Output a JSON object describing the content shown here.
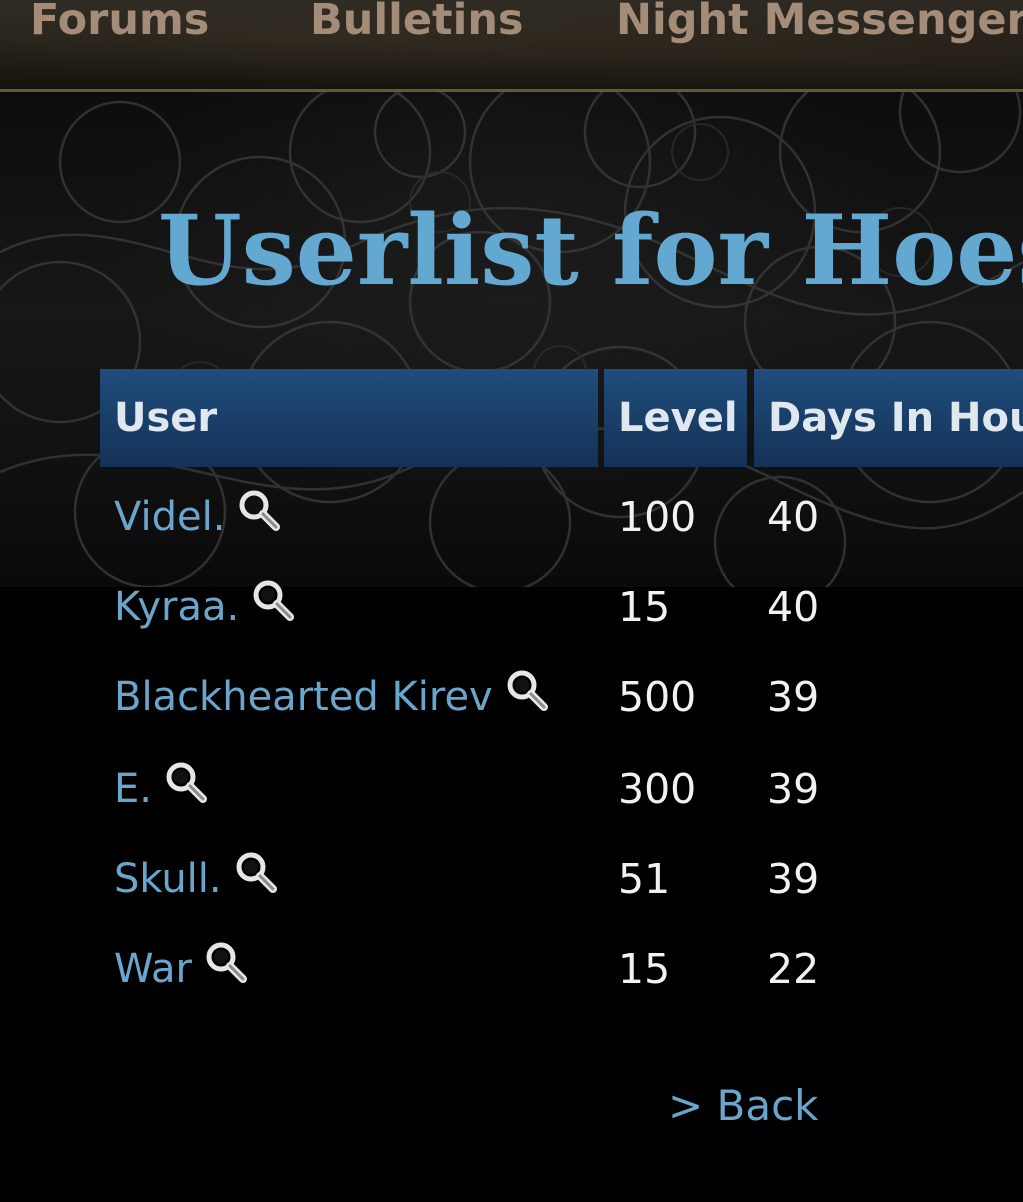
{
  "nav": {
    "items": [
      {
        "label": "Forums"
      },
      {
        "label": "Bulletins"
      },
      {
        "label": "Night Messenger"
      }
    ]
  },
  "page": {
    "title": "Userlist for Hoes"
  },
  "table": {
    "columns": [
      "User",
      "Level",
      "Days In Hou"
    ],
    "rows": [
      {
        "user": "Videl.",
        "level": "100",
        "days": "40"
      },
      {
        "user": "Kyraa.",
        "level": "15",
        "days": "40"
      },
      {
        "user": "Blackhearted Kirev",
        "level": "500",
        "days": "39"
      },
      {
        "user": "E.",
        "level": "300",
        "days": "39"
      },
      {
        "user": "Skull.",
        "level": "51",
        "days": "39"
      },
      {
        "user": "War",
        "level": "15",
        "days": "22"
      }
    ],
    "row_icon": "magnifier-icon"
  },
  "footer": {
    "back_label": "> Back"
  },
  "colors": {
    "link": "#6aa6cc",
    "title": "#63a8d0",
    "header_bg": "#1a3f69",
    "nav_text": "#a48c79",
    "background": "#000000"
  }
}
